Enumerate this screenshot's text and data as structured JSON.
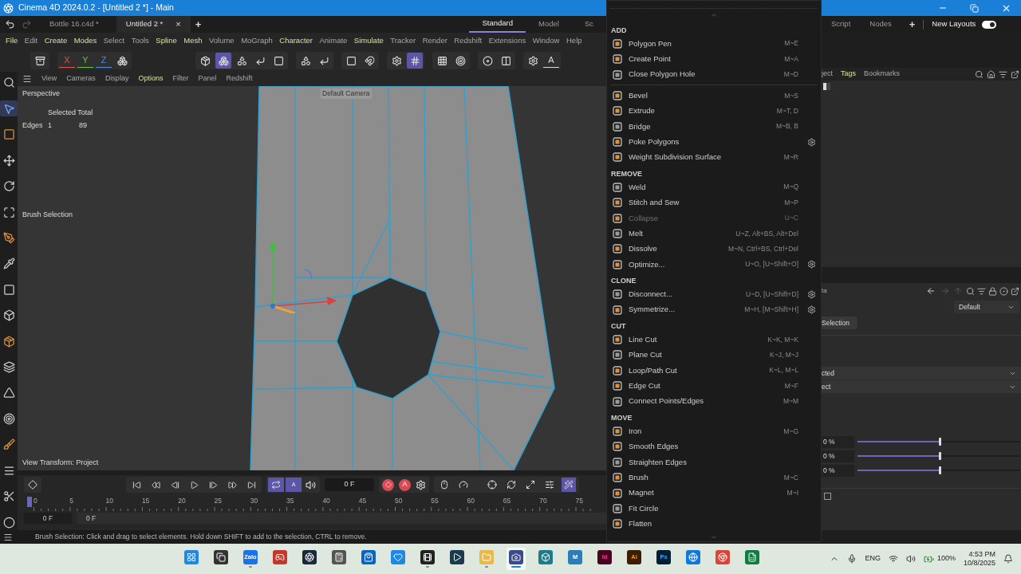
{
  "title_bar": {
    "title": "Cinema 4D 2024.0.2 - [Untitled 2 *] - Main"
  },
  "document_tabs": [
    {
      "label": "Bottle 16.c4d *",
      "selected": false
    },
    {
      "label": "Untitled 2 *",
      "selected": true
    }
  ],
  "close_tab": "×",
  "add_tab": "+",
  "layout_tabs_left": [
    {
      "label": "Standard",
      "selected": true
    },
    {
      "label": "Model",
      "selected": false
    },
    {
      "label": "Sc",
      "selected": false
    }
  ],
  "layout_tabs_right": [
    {
      "label": "Script",
      "selected": false
    },
    {
      "label": "Nodes",
      "selected": false
    }
  ],
  "add_layout": "+",
  "new_layouts": {
    "label": "New Layouts",
    "on": true
  },
  "menu_bar": [
    {
      "label": "File",
      "accent": true
    },
    {
      "label": "Edit",
      "accent": false
    },
    {
      "label": "Create",
      "accent": true
    },
    {
      "label": "Modes",
      "accent": true
    },
    {
      "label": "Select",
      "accent": false
    },
    {
      "label": "Tools",
      "accent": false
    },
    {
      "label": "Spline",
      "accent": true
    },
    {
      "label": "Mesh",
      "accent": true
    },
    {
      "label": "Volume",
      "accent": false
    },
    {
      "label": "MoGraph",
      "accent": false
    },
    {
      "label": "Character",
      "accent": true
    },
    {
      "label": "Animate",
      "accent": false
    },
    {
      "label": "Simulate",
      "accent": true
    },
    {
      "label": "Tracker",
      "accent": false
    },
    {
      "label": "Render",
      "accent": false
    },
    {
      "label": "Redshift",
      "accent": false
    },
    {
      "label": "Extensions",
      "accent": false
    },
    {
      "label": "Window",
      "accent": false
    },
    {
      "label": "Help",
      "accent": false
    }
  ],
  "toolbar": [
    {
      "buttons": [
        {
          "kind": "icon",
          "selected": false
        }
      ]
    },
    {
      "buttons": [
        {
          "kind": "letter",
          "text": "X",
          "color": "#e05252"
        },
        {
          "kind": "letter",
          "text": "Y",
          "color": "#6cc04a"
        },
        {
          "kind": "letter",
          "text": "Z",
          "color": "#4a8fe0"
        },
        {
          "kind": "icon",
          "selected": false
        }
      ]
    },
    {
      "buttons": [
        {
          "kind": "icon",
          "selected": false
        },
        {
          "kind": "icon",
          "selected": true
        },
        {
          "kind": "icon",
          "selected": false
        },
        {
          "kind": "icon",
          "selected": false
        },
        {
          "kind": "icon",
          "selected": false
        }
      ]
    },
    {
      "buttons": [
        {
          "kind": "icon",
          "selected": false
        },
        {
          "kind": "icon",
          "selected": false
        }
      ]
    },
    {
      "buttons": [
        {
          "kind": "icon",
          "selected": false
        },
        {
          "kind": "icon",
          "selected": false
        }
      ]
    },
    {
      "buttons": [
        {
          "kind": "icon",
          "selected": false
        },
        {
          "kind": "icon",
          "selected": true
        }
      ]
    },
    {
      "buttons": [
        {
          "kind": "icon",
          "selected": false
        },
        {
          "kind": "icon",
          "selected": false
        }
      ]
    },
    {
      "buttons": [
        {
          "kind": "icon",
          "selected": false
        },
        {
          "kind": "icon",
          "selected": false
        }
      ]
    },
    {
      "buttons": [
        {
          "kind": "icon",
          "selected": false
        },
        {
          "kind": "letter",
          "text": "A",
          "color": "#d8d8d8"
        }
      ]
    }
  ],
  "left_tools": [
    {
      "selected": false
    },
    {
      "selected": true
    },
    {
      "selected": false
    },
    {
      "selected": false
    },
    {
      "selected": false
    },
    {
      "selected": false
    },
    {
      "selected": false
    },
    {
      "selected": false
    },
    {
      "selected": false
    },
    {
      "selected": false
    },
    {
      "selected": false
    },
    {
      "selected": false
    },
    {
      "selected": false
    },
    {
      "selected": false
    },
    {
      "selected": false
    },
    {
      "selected": false
    },
    {
      "selected": false
    },
    {
      "selected": false
    }
  ],
  "viewport_menu": [
    {
      "label": "View",
      "accent": false
    },
    {
      "label": "Cameras",
      "accent": false
    },
    {
      "label": "Display",
      "accent": false
    },
    {
      "label": "Options",
      "accent": true
    },
    {
      "label": "Filter",
      "accent": false
    },
    {
      "label": "Panel",
      "accent": false
    },
    {
      "label": "Redshift",
      "accent": false
    }
  ],
  "viewport": {
    "camera": "Perspective",
    "default_camera": "Default Camera",
    "stats_title": "Selected Total",
    "stats_label": "Edges",
    "stats_selected": "1",
    "stats_total": "89",
    "tool_name": "Brush Selection",
    "view_transform": "View Transform: Project"
  },
  "timeline": {
    "transport": [
      {
        "selected": false
      },
      {
        "selected": false
      },
      {
        "selected": false
      },
      {
        "selected": false
      },
      {
        "selected": false
      },
      {
        "selected": false
      },
      {
        "selected": false
      }
    ],
    "loop": {
      "selected": true
    },
    "range_letter": "A",
    "frame": "0 F",
    "autokey": "A",
    "tools": [
      {
        "selected": false
      },
      {
        "selected": false
      },
      {
        "selected": false
      },
      {
        "selected": false
      },
      {
        "selected": false
      },
      {
        "selected": false
      },
      {
        "selected": true
      }
    ],
    "ruler": [
      "0",
      "5",
      "10",
      "15",
      "20",
      "25",
      "30",
      "35",
      "40",
      "45",
      "50",
      "55",
      "60",
      "65",
      "70",
      "75"
    ],
    "start": "0 F",
    "end": "0 F"
  },
  "status_bar": "Brush Selection: Click and drag to select elements. Hold down SHIFT to add to the selection, CTRL to remove.",
  "popup_menu": {
    "sections": [
      {
        "title": "ADD",
        "items": [
          {
            "label": "Polygon Pen",
            "shortcut": "M~E",
            "disabled": false,
            "settings": false
          },
          {
            "label": "Create Point",
            "shortcut": "M~A",
            "disabled": false,
            "settings": false
          },
          {
            "label": "Close Polygon Hole",
            "shortcut": "M~D",
            "disabled": false,
            "settings": false
          }
        ]
      },
      {
        "items": [
          {
            "label": "Bevel",
            "shortcut": "M~S",
            "disabled": false,
            "settings": false
          },
          {
            "label": "Extrude",
            "shortcut": "M~T, D",
            "disabled": false,
            "settings": false
          },
          {
            "label": "Bridge",
            "shortcut": "M~B, B",
            "disabled": false,
            "settings": false
          },
          {
            "label": "Poke Polygons",
            "disabled": false,
            "settings": true
          },
          {
            "label": "Weight Subdivision Surface",
            "shortcut": "M~R",
            "disabled": false,
            "settings": false
          }
        ]
      },
      {
        "title": "REMOVE",
        "items": [
          {
            "label": "Weld",
            "shortcut": "M~Q",
            "disabled": false,
            "settings": false
          },
          {
            "label": "Stitch and Sew",
            "shortcut": "M~P",
            "disabled": false,
            "settings": false
          },
          {
            "label": "Collapse",
            "shortcut": "U~C",
            "disabled": true,
            "settings": false
          },
          {
            "label": "Melt",
            "shortcut": "U~Z, Alt+BS, Alt+Del",
            "disabled": false,
            "settings": false
          },
          {
            "label": "Dissolve",
            "shortcut": "M~N, Ctrl+BS, Ctrl+Del",
            "disabled": false,
            "settings": false
          },
          {
            "label": "Optimize...",
            "shortcut": "U~O, [U~Shift+O]",
            "disabled": false,
            "settings": true
          }
        ]
      },
      {
        "title": "CLONE",
        "items": [
          {
            "label": "Disconnect...",
            "shortcut": "U~D, [U~Shift+D]",
            "disabled": false,
            "settings": true
          },
          {
            "label": "Symmetrize...",
            "shortcut": "M~H, [M~Shift+H]",
            "disabled": false,
            "settings": true
          }
        ]
      },
      {
        "title": "CUT",
        "items": [
          {
            "label": "Line Cut",
            "shortcut": "K~K, M~K",
            "disabled": false,
            "settings": false
          },
          {
            "label": "Plane Cut",
            "shortcut": "K~J, M~J",
            "disabled": false,
            "settings": false
          },
          {
            "label": "Loop/Path Cut",
            "shortcut": "K~L, M~L",
            "disabled": false,
            "settings": false
          },
          {
            "label": "Edge Cut",
            "shortcut": "M~F",
            "disabled": false,
            "settings": false
          },
          {
            "label": "Connect Points/Edges",
            "shortcut": "M~M",
            "disabled": false,
            "settings": false
          }
        ]
      },
      {
        "title": "MOVE",
        "items": [
          {
            "label": "Iron",
            "shortcut": "M~G",
            "disabled": false,
            "settings": false
          },
          {
            "label": "Smooth Edges",
            "disabled": false,
            "settings": false
          },
          {
            "label": "Straighten Edges",
            "disabled": false,
            "settings": false
          },
          {
            "label": "Brush",
            "shortcut": "M~C",
            "disabled": false,
            "settings": false
          },
          {
            "label": "Magnet",
            "shortcut": "M~I",
            "disabled": false,
            "settings": false
          },
          {
            "label": "Fit Circle",
            "disabled": false,
            "settings": false
          },
          {
            "label": "Flatten",
            "disabled": false,
            "settings": false
          }
        ]
      }
    ]
  },
  "object_manager": {
    "tabs": [
      {
        "label": "ject",
        "selected": false
      },
      {
        "label": "Tags",
        "selected": true
      },
      {
        "label": "Bookmarks",
        "selected": false
      }
    ]
  },
  "attributes": {
    "title": "ta",
    "preset": "Default",
    "selection_button": "Selection",
    "dropdowns": [
      "cted",
      "ect"
    ],
    "sliders": [
      {
        "value": "0 %",
        "level": 0.5
      },
      {
        "value": "0 %",
        "level": 0.5
      },
      {
        "value": "0 %",
        "level": 0.5
      }
    ],
    "checkbox": {
      "checked": false
    }
  },
  "taskbar": {
    "apps": [
      {
        "running": false,
        "selected": false
      },
      {
        "running": false,
        "selected": false
      },
      {
        "label": "Zalo",
        "running": true,
        "selected": false
      },
      {
        "running": false,
        "selected": false
      },
      {
        "running": false,
        "selected": false
      },
      {
        "running": false,
        "selected": false
      },
      {
        "running": false,
        "selected": false
      },
      {
        "running": false,
        "selected": false
      },
      {
        "running": true,
        "selected": false
      },
      {
        "running": false,
        "selected": false
      },
      {
        "running": true,
        "selected": false
      },
      {
        "running": true,
        "selected": true
      },
      {
        "running": false,
        "selected": false
      },
      {
        "label": "M",
        "running": false,
        "selected": false
      },
      {
        "label": "Id",
        "running": false,
        "selected": false
      },
      {
        "label": "Ai",
        "running": false,
        "selected": false
      },
      {
        "label": "Ps",
        "running": false,
        "selected": false
      },
      {
        "running": false,
        "selected": false
      },
      {
        "running": false,
        "selected": false
      },
      {
        "running": false,
        "selected": false
      }
    ],
    "tray": {
      "language": "ENG",
      "battery": "100%",
      "time": "4:53 PM",
      "date": "10/8/2025"
    }
  }
}
